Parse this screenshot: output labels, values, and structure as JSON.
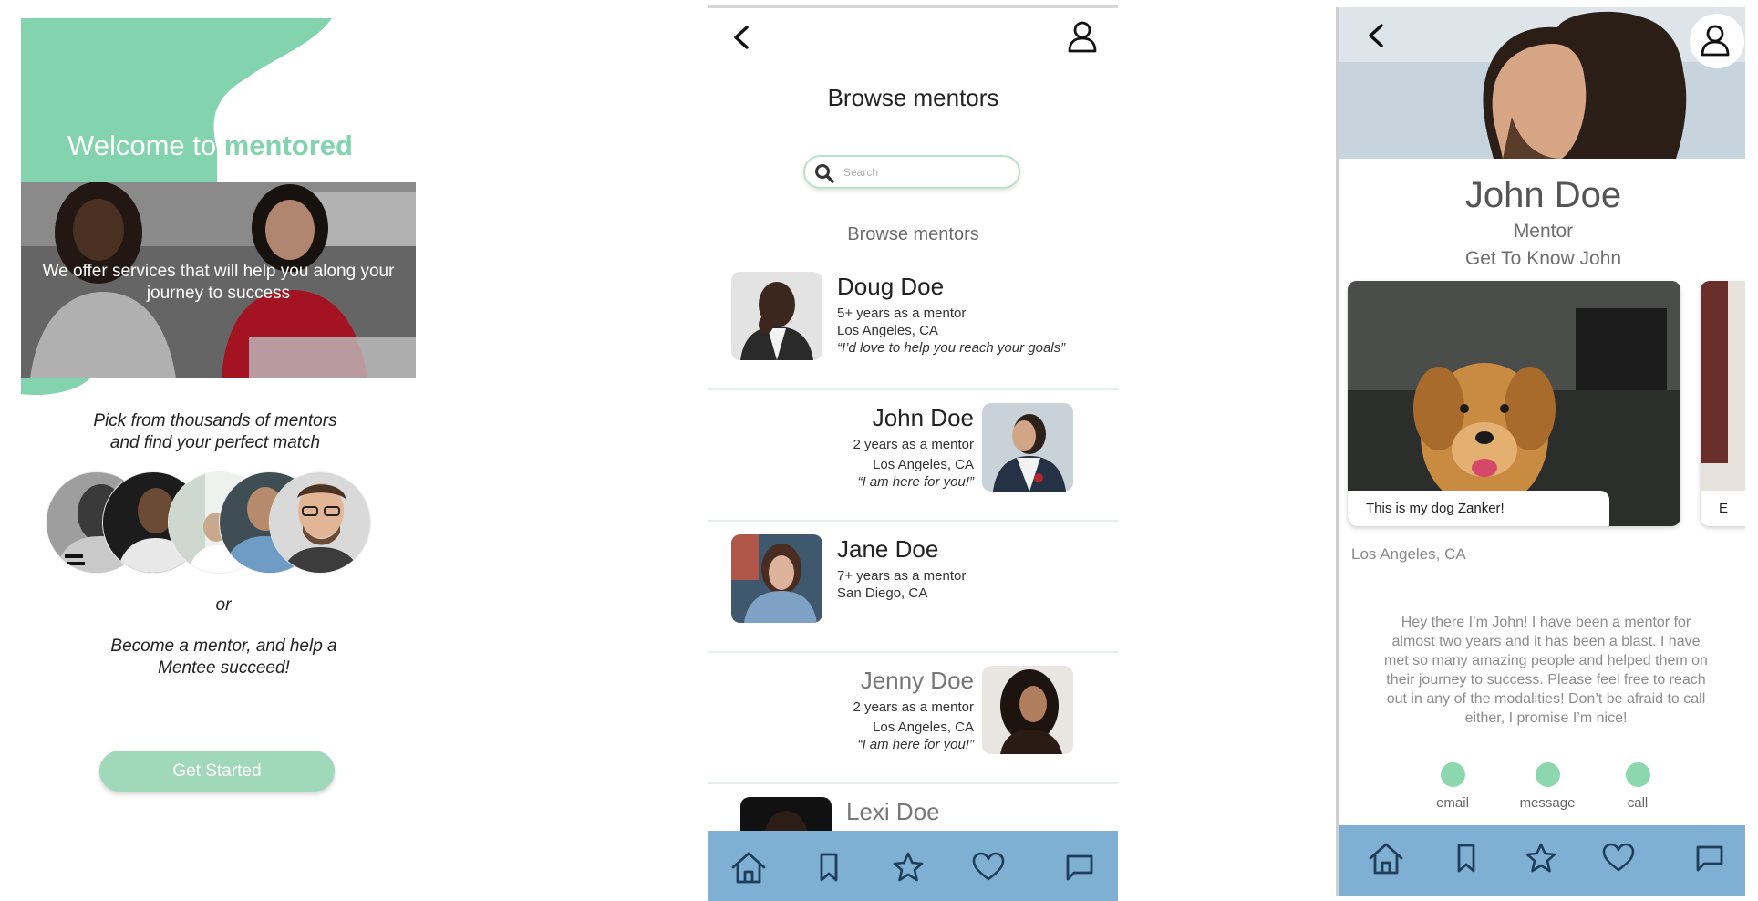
{
  "colors": {
    "brand_green": "#83d4ae",
    "button_green": "#9fd9b9",
    "tabbar_blue": "#80afd4",
    "dot_green": "#8dd7ae"
  },
  "welcome": {
    "title_prefix": "Welcome to ",
    "title_brand": "mentored",
    "hero_text": "We offer services that will help you along your journey to success",
    "pick_text": "Pick from thousands of mentors and find your perfect match",
    "or_text": "or",
    "become_text": "Become a mentor, and help a Mentee succeed!",
    "cta_label": "Get Started"
  },
  "browse": {
    "title": "Browse mentors",
    "search_placeholder": "Search",
    "section_label": "Browse mentors",
    "mentors": [
      {
        "name": "Doug Doe",
        "experience": "5+ years as a mentor",
        "location": "Los Angeles, CA",
        "quote": "“I’d love to help you reach your goals”"
      },
      {
        "name": "John Doe",
        "experience": "2 years as a mentor",
        "location": "Los Angeles, CA",
        "quote": "“I am here for you!”"
      },
      {
        "name": "Jane Doe",
        "experience": "7+ years as a mentor",
        "location": "San Diego, CA",
        "quote": ""
      },
      {
        "name": "Jenny Doe",
        "experience": "2 years as a mentor",
        "location": "Los Angeles, CA",
        "quote": "“I am here for you!”"
      },
      {
        "name": "Lexi Doe",
        "experience": "",
        "location": "",
        "quote": ""
      }
    ]
  },
  "tabbar": {
    "icons": [
      "home-icon",
      "bookmark-icon",
      "star-icon",
      "heart-icon",
      "chat-icon"
    ]
  },
  "profile": {
    "name": "John Doe",
    "role": "Mentor",
    "get_to_know": "Get To Know John",
    "photo_caption": "This is my dog Zanker!",
    "photo2_caption": "E",
    "location": "Los Angeles, CA",
    "bio": "Hey there I’m John! I have been a mentor for almost two years and it has been a blast. I have met so many amazing people and helped them on their journey to success. Please feel free to reach out in any of the modalities! Don’t be afraid to call either, I promise I’m nice!",
    "contacts": [
      "email",
      "message",
      "call"
    ]
  }
}
